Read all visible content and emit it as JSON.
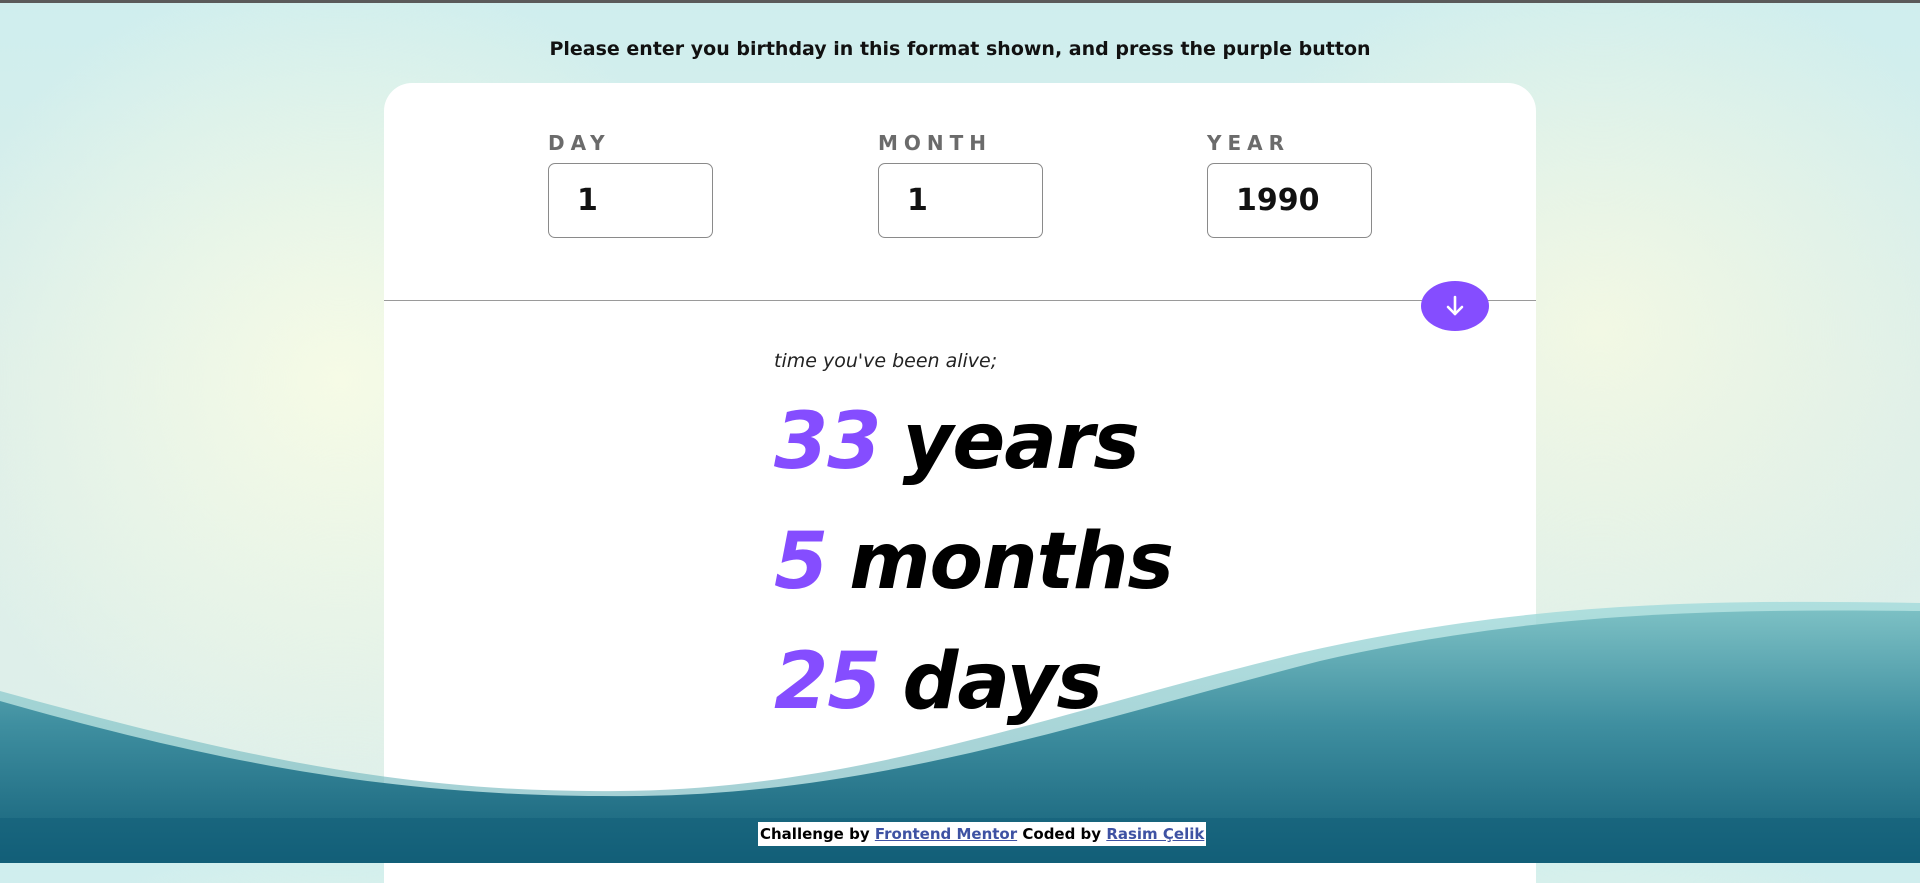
{
  "instruction": "Please enter you birthday in this format shown, and press the purple button",
  "form": {
    "day": {
      "label": "DAY",
      "value": "1"
    },
    "month": {
      "label": "MONTH",
      "value": "1"
    },
    "year": {
      "label": "YEAR",
      "value": "1990"
    },
    "submit_icon": "arrow-down-icon"
  },
  "results": {
    "caption": "time you've been alive;",
    "years": {
      "value": "33",
      "unit": "years"
    },
    "months": {
      "value": "5",
      "unit": "months"
    },
    "days": {
      "value": "25",
      "unit": "days"
    }
  },
  "footer": {
    "challenge_prefix": "Challenge by",
    "challenge_link": "Frontend Mentor",
    "coded_prefix": "Coded by",
    "coded_link": "Rasim Çelik"
  },
  "colors": {
    "accent": "#854dff",
    "link": "#3e52a3",
    "wave_dark": "#1b6b80",
    "wave_light": "#8fcfd0"
  }
}
